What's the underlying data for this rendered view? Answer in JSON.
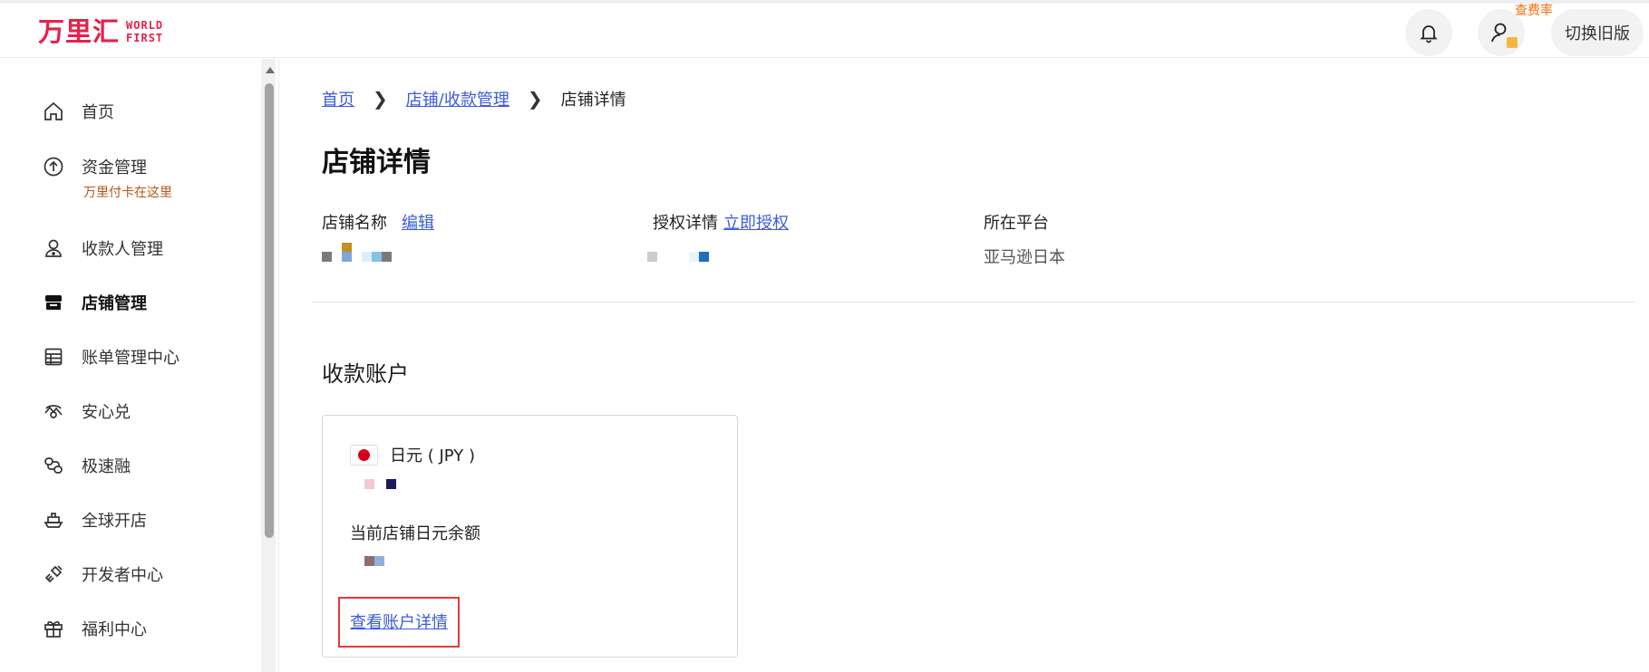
{
  "header": {
    "logo_cn": "万里汇",
    "logo_en_line1": "WORLD",
    "logo_en_line2": "FIRST",
    "fee_badge": "查费率",
    "switch_label": "切换旧版"
  },
  "sidebar": {
    "items": [
      {
        "label": "首页",
        "icon": "home-icon"
      },
      {
        "label": "资金管理",
        "icon": "upload-circle-icon",
        "sub": "万里付卡在这里"
      },
      {
        "label": "收款人管理",
        "icon": "payee-icon"
      },
      {
        "label": "店铺管理",
        "icon": "store-icon",
        "active": true
      },
      {
        "label": "账单管理中心",
        "icon": "bill-icon"
      },
      {
        "label": "安心兑",
        "icon": "exchange-icon"
      },
      {
        "label": "极速融",
        "icon": "finance-icon"
      },
      {
        "label": "全球开店",
        "icon": "ship-icon"
      },
      {
        "label": "开发者中心",
        "icon": "developer-icon"
      },
      {
        "label": "福利中心",
        "icon": "gift-icon"
      }
    ]
  },
  "breadcrumb": {
    "home": "首页",
    "store_mgmt": "店铺/收款管理",
    "current": "店铺详情"
  },
  "page": {
    "title": "店铺详情",
    "store_name_label": "店铺名称",
    "edit_link": "编辑",
    "auth_label": "授权详情",
    "auth_link": "立即授权",
    "platform_label": "所在平台",
    "platform_value": "亚马逊日本"
  },
  "account": {
    "section_title": "收款账户",
    "currency": "日元 ( JPY )",
    "balance_label": "当前店铺日元余额",
    "view_details": "查看账户详情"
  },
  "colors": {
    "brand": "#e5224b",
    "link": "#3b5bdb",
    "highlight_box": "#e53935",
    "fee_badge": "#ff6a00"
  }
}
